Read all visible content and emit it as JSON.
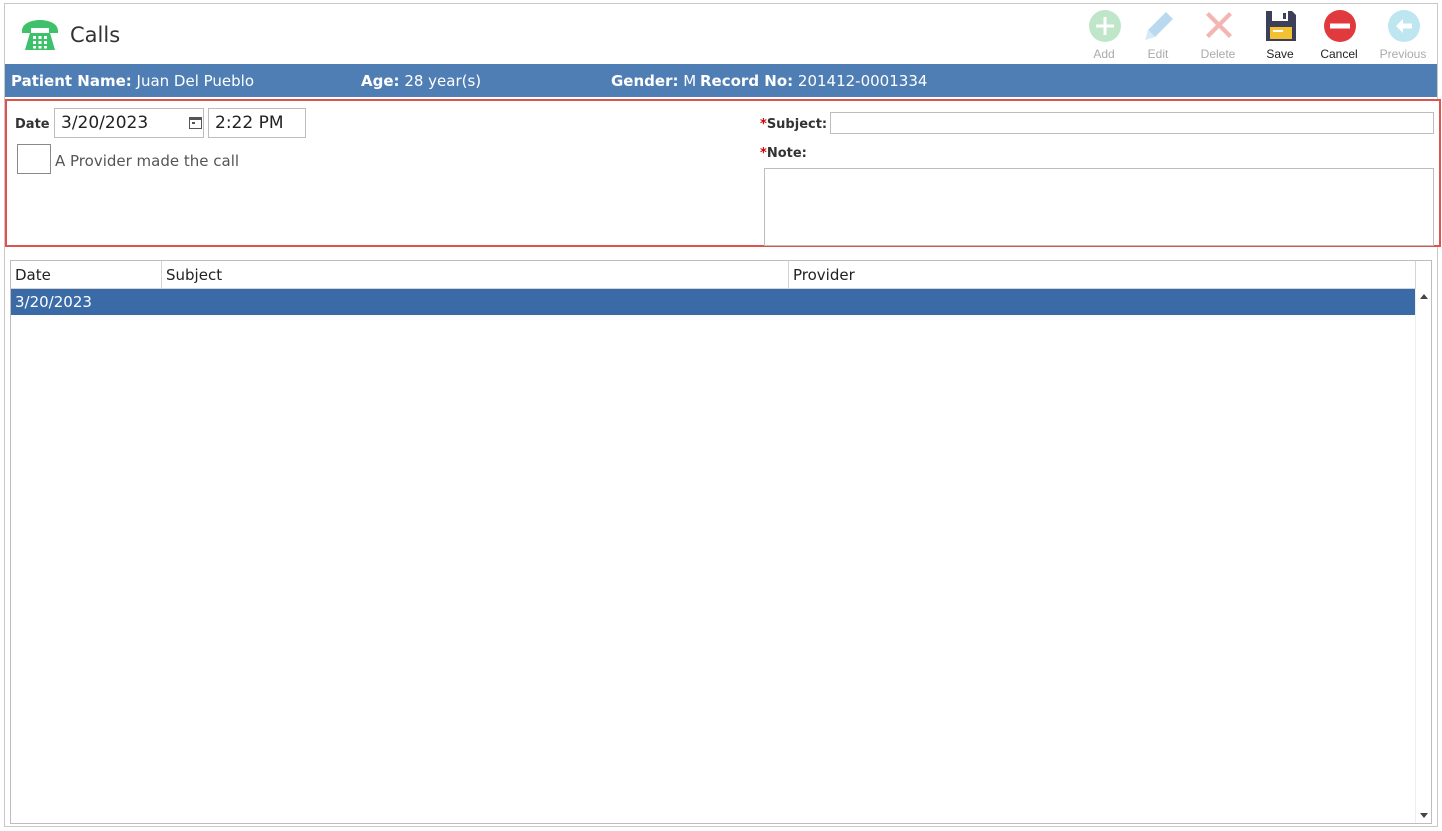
{
  "window": {
    "title": "Calls"
  },
  "toolbar": {
    "add_label": "Add",
    "edit_label": "Edit",
    "delete_label": "Delete",
    "save_label": "Save",
    "cancel_label": "Cancel",
    "previous_label": "Previous"
  },
  "patient": {
    "name_label": "Patient Name:",
    "name_value": "Juan Del Pueblo",
    "age_label": "Age:",
    "age_value": "28 year(s)",
    "gender_label": "Gender:",
    "gender_value": "M",
    "record_label": "Record No:",
    "record_value": "201412-0001334"
  },
  "form": {
    "date_label": "Date",
    "date_value": "3/20/2023",
    "time_value": "2:22 PM",
    "provider_checkbox_label": "A Provider made the call",
    "provider_checked": false,
    "required_marker": "*",
    "subject_label": "Subject:",
    "subject_value": "",
    "note_label": "Note:",
    "note_value": ""
  },
  "grid": {
    "columns": [
      "Date",
      "Subject",
      "Provider"
    ],
    "rows": [
      {
        "date": "3/20/2023",
        "subject": "",
        "provider": ""
      }
    ]
  },
  "colors": {
    "patient_bar": "#4f7eb5",
    "selected_row": "#3a6ba7",
    "form_border": "#e0524c",
    "required": "#d40000"
  },
  "icons": {
    "title": "phone-icon",
    "add": "plus-circle-icon",
    "edit": "pencil-icon",
    "delete": "x-icon",
    "save": "floppy-disk-icon",
    "cancel": "minus-circle-icon",
    "previous": "arrow-left-circle-icon",
    "calendar": "calendar-icon"
  }
}
